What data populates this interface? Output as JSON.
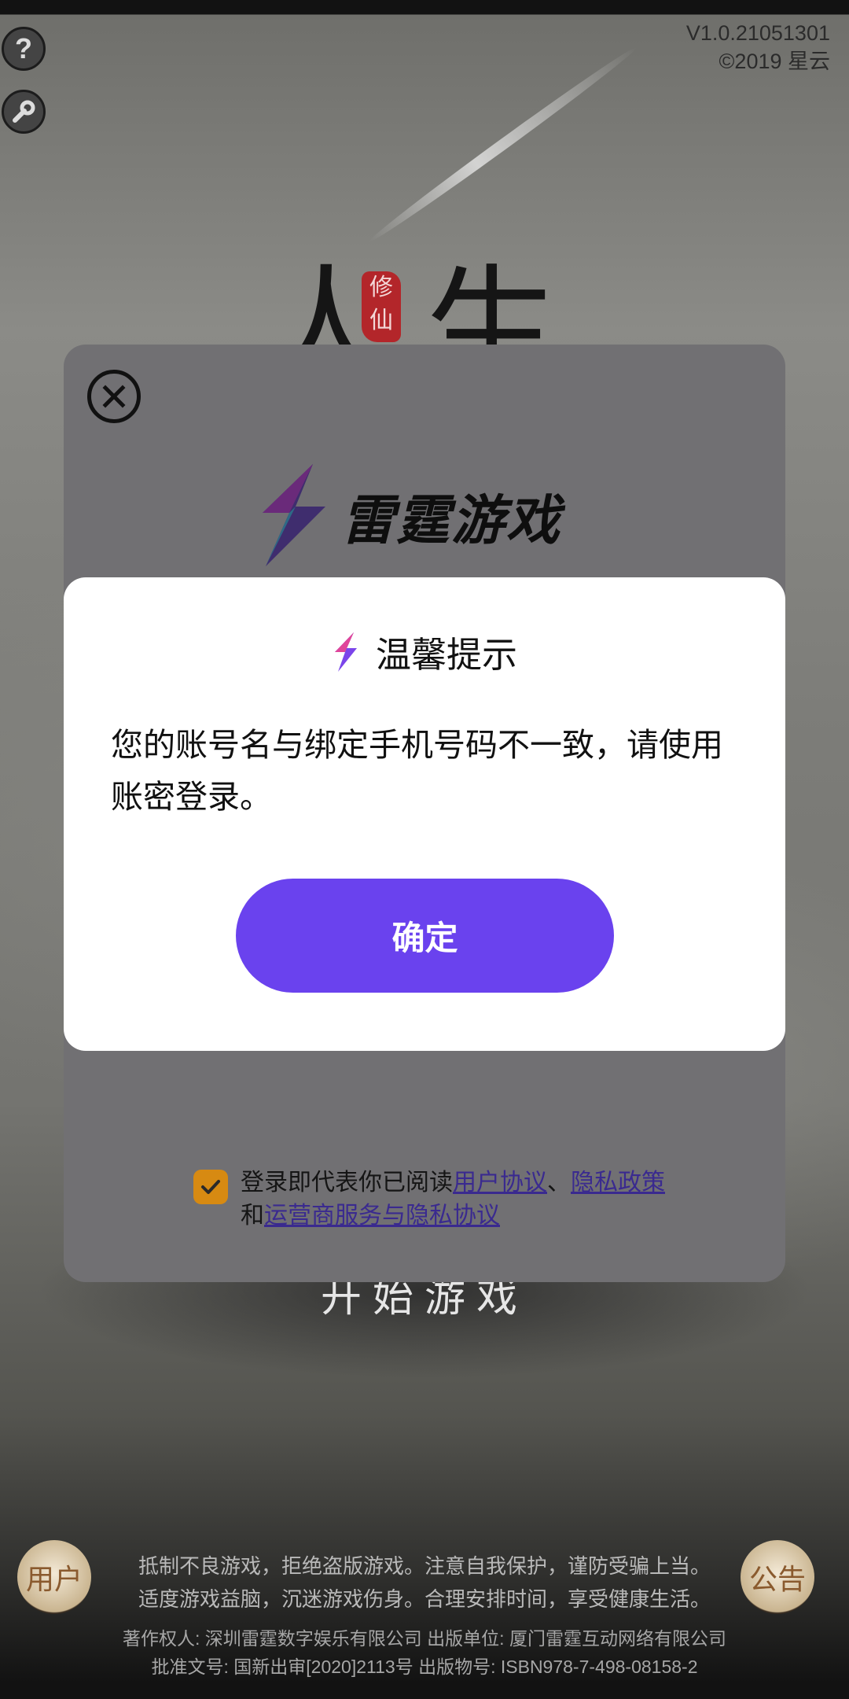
{
  "game": {
    "version": "V1.0.21051301",
    "copyright": "©2019 星云",
    "help_label": "?",
    "title_glyphs": "人生一世",
    "seal_text": "修仙",
    "start_label": "开始游戏",
    "user_corner_label": "用户",
    "notice_corner_label": "公告",
    "notice_line1": "抵制不良游戏，拒绝盗版游戏。注意自我保护，谨防受骗上当。",
    "notice_line2": "适度游戏益脑，沉迷游戏伤身。合理安排时间，享受健康生活。",
    "legal_line1": "著作权人: 深圳雷霆数字娱乐有限公司 出版单位: 厦门雷霆互动网络有限公司",
    "legal_line2": "批准文号: 国新出审[2020]2113号 出版物号: ISBN978-7-498-08158-2"
  },
  "login": {
    "brand_name": "雷霆游戏",
    "agreement_prefix": "登录即代表你已阅读",
    "user_agreement": "用户协议",
    "separator": "、",
    "privacy_policy": "隐私政策",
    "and_word": "和",
    "operator_agreement": "运营商服务与隐私协议",
    "agreement_checked": true
  },
  "dialog": {
    "title": "温馨提示",
    "message": "您的账号名与绑定手机号码不一致，请使用账密登录。",
    "confirm_label": "确定"
  },
  "colors": {
    "accent": "#6a42ee",
    "checkbox": "#d78a12",
    "link": "#3a2a8f"
  }
}
